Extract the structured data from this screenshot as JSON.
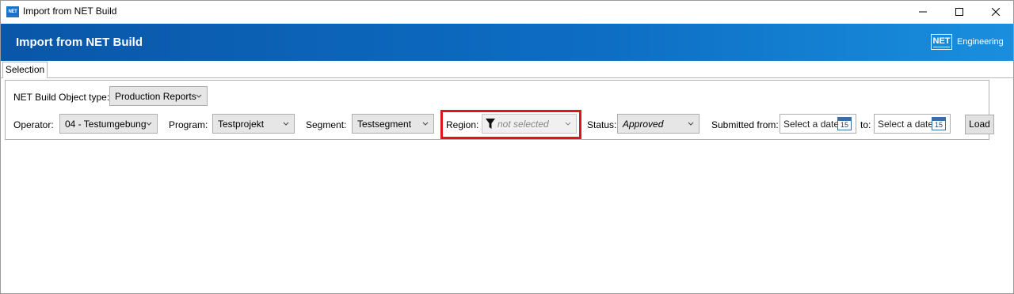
{
  "window": {
    "title": "Import from NET Build",
    "app_icon_text": "NET",
    "controls": [
      "minimize-icon",
      "maximize-icon",
      "close-icon"
    ]
  },
  "banner": {
    "title": "Import from NET Build",
    "logo_mark": "NET",
    "logo_text": "Engineering"
  },
  "tabs": [
    {
      "label": "Selection",
      "active": true
    }
  ],
  "filters": {
    "object_type": {
      "label": "NET Build Object type:",
      "value": "Production Reports"
    },
    "operator": {
      "label": "Operator:",
      "value": "04 - Testumgebung"
    },
    "program": {
      "label": "Program:",
      "value": "Testprojekt"
    },
    "segment": {
      "label": "Segment:",
      "value": "Testsegment"
    },
    "region": {
      "label": "Region:",
      "placeholder": "not selected",
      "icon": "filter-icon"
    },
    "status": {
      "label": "Status:",
      "value": "Approved"
    },
    "submitted_from": {
      "label": "Submitted from:",
      "placeholder": "Select a date",
      "cal_day": "15"
    },
    "submitted_to": {
      "label": "to:",
      "placeholder": "Select a date",
      "cal_day": "15"
    },
    "load_button": "Load"
  },
  "colors": {
    "banner_start": "#0a56a8",
    "banner_end": "#1a8fde",
    "highlight": "#e0141e"
  }
}
